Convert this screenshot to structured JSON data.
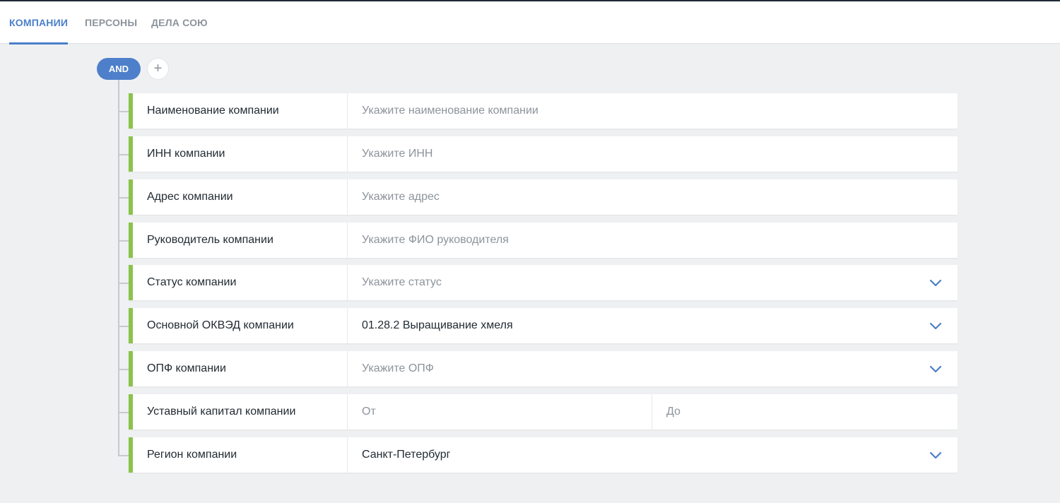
{
  "tabs": [
    {
      "label": "КОМПАНИИ",
      "active": true
    },
    {
      "label": "ПЕРСОНЫ",
      "active": false
    },
    {
      "label": "ДЕЛА СОЮ",
      "active": false
    }
  ],
  "query": {
    "operator_label": "AND",
    "add_label": "+"
  },
  "rows": [
    {
      "label": "Наименование компании",
      "placeholder": "Укажите наименование компании"
    },
    {
      "label": "ИНН компании",
      "placeholder": "Укажите ИНН"
    },
    {
      "label": "Адрес компании",
      "placeholder": "Укажите адрес"
    },
    {
      "label": "Руководитель компании",
      "placeholder": "Укажите ФИО руководителя"
    },
    {
      "label": "Статус компании",
      "placeholder": "Укажите статус"
    },
    {
      "label": "Основной ОКВЭД компании",
      "value": "01.28.2 Выращивание хмеля"
    },
    {
      "label": "ОПФ компании",
      "placeholder": "Укажите ОПФ"
    },
    {
      "label": "Уставный капитал компании",
      "from_placeholder": "От",
      "to_placeholder": "До"
    },
    {
      "label": "Регион компании",
      "value": "Санкт-Петербург"
    }
  ],
  "colors": {
    "accent": "#4a7fca",
    "row_marker": "#8bc34a",
    "background": "#eff0f2"
  },
  "icons": {
    "dropdown": "chevron-down-icon",
    "add": "plus-icon"
  }
}
